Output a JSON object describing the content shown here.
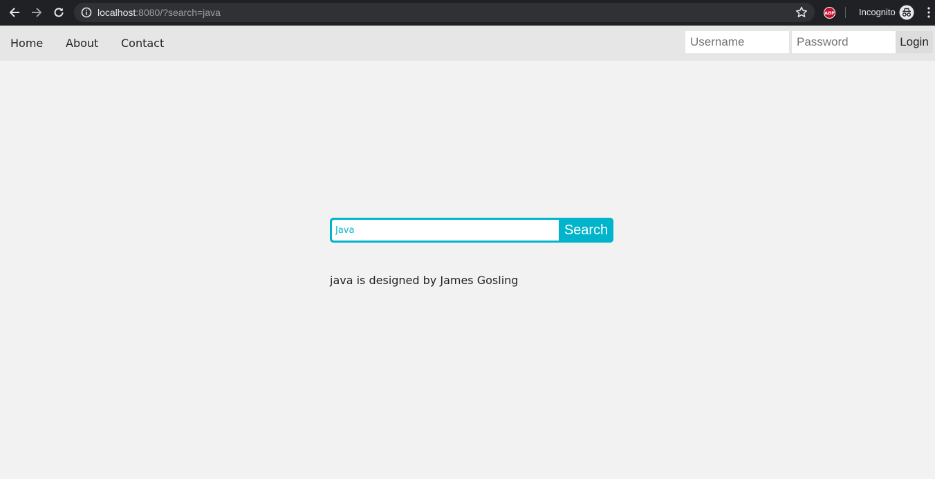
{
  "browser": {
    "url_host": "localhost",
    "url_rest": ":8080/?search=java",
    "incognito_label": "Incognito",
    "adblock_badge": "ABP",
    "icons": [
      "back-arrow-icon",
      "forward-arrow-icon",
      "reload-icon",
      "info-icon",
      "star-icon",
      "adblock-icon",
      "incognito-icon",
      "more-vert-icon"
    ]
  },
  "nav": {
    "links": [
      {
        "label": "Home"
      },
      {
        "label": "About"
      },
      {
        "label": "Contact"
      }
    ],
    "username_placeholder": "Username",
    "password_placeholder": "Password",
    "login_label": "Login"
  },
  "search": {
    "value": "Java",
    "button_label": "Search",
    "accent_color": "#00b4cc"
  },
  "result": {
    "text": "java is designed by James Gosling"
  }
}
